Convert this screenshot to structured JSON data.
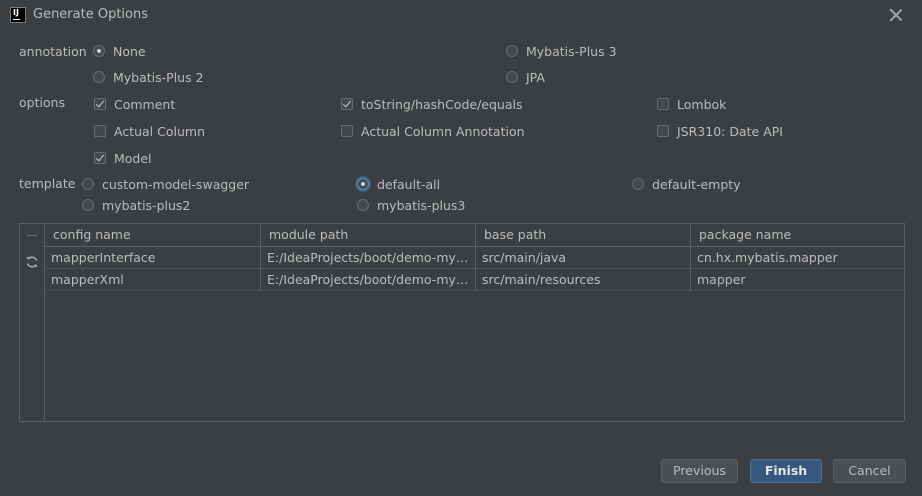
{
  "window": {
    "title": "Generate Options",
    "app_icon_text": "IJ"
  },
  "annotation": {
    "label": "annotation",
    "options": [
      "None",
      "Mybatis-Plus 3",
      "Mybatis-Plus 2",
      "JPA"
    ],
    "selected": "None"
  },
  "options": {
    "label": "options",
    "items": [
      {
        "label": "Comment",
        "checked": true
      },
      {
        "label": "toString/hashCode/equals",
        "checked": true
      },
      {
        "label": "Lombok",
        "checked": false
      },
      {
        "label": "Actual Column",
        "checked": false
      },
      {
        "label": "Actual Column Annotation",
        "checked": false
      },
      {
        "label": "JSR310: Date API",
        "checked": false
      },
      {
        "label": "Model",
        "checked": true
      }
    ]
  },
  "template": {
    "label": "template",
    "options": [
      "custom-model-swagger",
      "default-all",
      "default-empty",
      "mybatis-plus2",
      "mybatis-plus3"
    ],
    "selected": "default-all"
  },
  "table": {
    "columns": [
      "config name",
      "module path",
      "base path",
      "package name"
    ],
    "rows": [
      [
        "mapperInterface",
        "E:/IdeaProjects/boot/demo-myba...",
        "src/main/java",
        "cn.hx.mybatis.mapper"
      ],
      [
        "mapperXml",
        "E:/IdeaProjects/boot/demo-myba...",
        "src/main/resources",
        "mapper"
      ]
    ]
  },
  "buttons": {
    "previous": "Previous",
    "finish": "Finish",
    "cancel": "Cancel"
  },
  "colors": {
    "background": "#3c3f41",
    "primary_button": "#365880",
    "text": "#bbbbbb"
  }
}
